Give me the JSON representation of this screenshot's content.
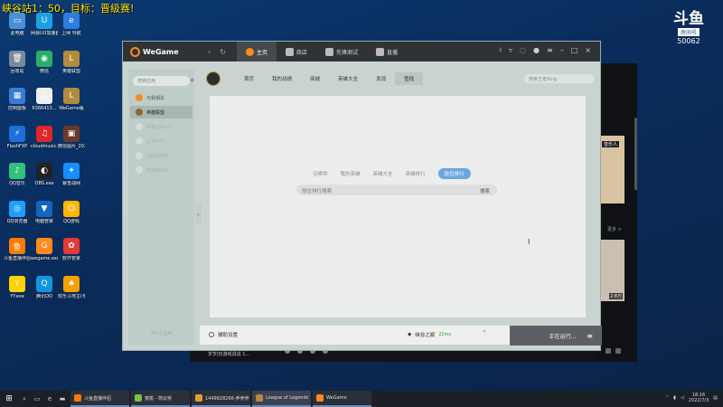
{
  "overlay": {
    "title": "峡谷站1：50，目标：晋级赛!",
    "logo_glyph": "斗鱼",
    "logo_sub": "房间号",
    "room_number": "50062"
  },
  "desktop_icons": [
    {
      "label": "此电脑",
      "color": "#4a90d9",
      "glyph": "▭"
    },
    {
      "label": "网易UU加速器",
      "color": "#1ba1e2",
      "glyph": "U"
    },
    {
      "label": "上网 导航",
      "color": "#2b7de1",
      "glyph": "e"
    },
    {
      "label": "回收站",
      "color": "#7a8a9a",
      "glyph": "🗑"
    },
    {
      "label": "微信",
      "color": "#2aae67",
      "glyph": "◉"
    },
    {
      "label": "英雄联盟",
      "color": "#b48a3c",
      "glyph": "L"
    },
    {
      "label": "控制面板",
      "color": "#3a7bd5",
      "glyph": "▦"
    },
    {
      "label": "6366413...",
      "color": "#eee",
      "glyph": "斗"
    },
    {
      "label": "WeGame版",
      "color": "#b48a3c",
      "glyph": "L"
    },
    {
      "label": "FlashFXP",
      "color": "#1e6fd9",
      "glyph": "⚡"
    },
    {
      "label": "cloudmusic...",
      "color": "#e0252b",
      "glyph": "♫"
    },
    {
      "label": "微信图片_2022061...",
      "color": "#6b3a2a",
      "glyph": "▣"
    },
    {
      "label": "QQ音乐",
      "color": "#31c27c",
      "glyph": "♪"
    },
    {
      "label": "OBS.exe",
      "color": "#222",
      "glyph": "◐"
    },
    {
      "label": "暴雪战网",
      "color": "#148eff",
      "glyph": "✦"
    },
    {
      "label": "QQ浏览器",
      "color": "#1e9fff",
      "glyph": "◎"
    },
    {
      "label": "电脑管家",
      "color": "#1565c0",
      "glyph": "▼"
    },
    {
      "label": "QQ游戏",
      "color": "#ffb400",
      "glyph": "☺"
    },
    {
      "label": "斗鱼直播伴侣",
      "color": "#ff7a00",
      "glyph": "鱼"
    },
    {
      "label": "wegame.exe",
      "color": "#ff8a1e",
      "glyph": "G"
    },
    {
      "label": "软件管家",
      "color": "#e53935",
      "glyph": "✿"
    },
    {
      "label": "YY.exe",
      "color": "#ffd200",
      "glyph": "Y"
    },
    {
      "label": "腾讯QQ",
      "color": "#1296db",
      "glyph": "Q"
    },
    {
      "label": "欢乐斗地主(手游电脑版)",
      "color": "#f4a000",
      "glyph": "♠"
    }
  ],
  "bg_window": {
    "card_tag": "音乐人",
    "more": "更多 >",
    "duration": "2:8万",
    "bottom_text": "岁岁|玩游戏说说 1..."
  },
  "wegame": {
    "brand": "WeGame",
    "tabs": [
      {
        "label": "主页",
        "active": true
      },
      {
        "label": "商店",
        "active": false
      },
      {
        "label": "先锋测试",
        "active": false
      },
      {
        "label": "直播",
        "active": false
      }
    ],
    "search_placeholder": "搜索应用",
    "sidebar": [
      {
        "label": "与我相关",
        "active": false,
        "dim": false,
        "icon_color": "#f28c28"
      },
      {
        "label": "英雄联盟",
        "active": true,
        "dim": false,
        "icon_color": "#8a6a2c"
      },
      {
        "label": "英雄大战+R...",
        "active": false,
        "dim": true,
        "icon_color": "#d5dddb"
      },
      {
        "label": "云顶TFT...",
        "active": false,
        "dim": true,
        "icon_color": "#d5dddb"
      },
      {
        "label": "H游戏游戏",
        "active": false,
        "dim": true,
        "icon_color": "#d5dddb"
      },
      {
        "label": "游戏库BOL",
        "active": false,
        "dim": true,
        "icon_color": "#d5dddb"
      }
    ],
    "sidebar_count": "共6个应用",
    "lol_tabs": [
      {
        "label": "首页",
        "active": false
      },
      {
        "label": "我的战绩",
        "active": false
      },
      {
        "label": "商城",
        "active": false
      },
      {
        "label": "英雄大全",
        "active": false
      },
      {
        "label": "发现",
        "active": false
      },
      {
        "label": "查找",
        "active": true
      }
    ],
    "lol_search_placeholder": "搜索王者Xing",
    "sub_tabs": [
      {
        "label": "召唤师",
        "active": false
      },
      {
        "label": "我的英雄",
        "active": false
      },
      {
        "label": "英雄大全",
        "active": false
      },
      {
        "label": "英雄排行",
        "active": false
      },
      {
        "label": "段位排行",
        "active": true
      }
    ],
    "rank_search_placeholder": "段位排行搜索",
    "rank_search_button": "搜索",
    "aux_label": "辅助设置",
    "server": "峡谷之巅",
    "ping": "22ms",
    "running": "正在运行..."
  },
  "taskbar": {
    "items": [
      {
        "label": "斗鱼直播伴侣",
        "color": "#ff7a00",
        "active": false
      },
      {
        "label": "蜜桃 - 简云桥",
        "color": "#7bc043",
        "active": false
      },
      {
        "label": "1449828266-养养养",
        "color": "#e0a030",
        "active": false
      },
      {
        "label": "League of Legends",
        "color": "#b48a3c",
        "active": true
      },
      {
        "label": "WeGame",
        "color": "#ff8a1e",
        "active": false
      }
    ],
    "time": "18:16",
    "date": "2022/7/3"
  }
}
